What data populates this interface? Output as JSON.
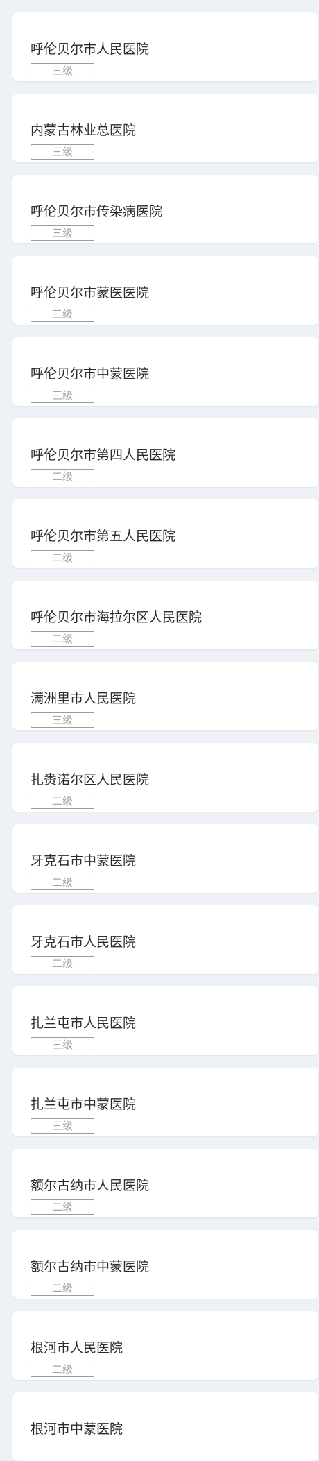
{
  "hospitals": [
    {
      "name": "呼伦贝尔市人民医院",
      "level": "三级"
    },
    {
      "name": "内蒙古林业总医院",
      "level": "三级"
    },
    {
      "name": "呼伦贝尔市传染病医院",
      "level": "三级"
    },
    {
      "name": "呼伦贝尔市蒙医医院",
      "level": "三级"
    },
    {
      "name": "呼伦贝尔市中蒙医院",
      "level": "三级"
    },
    {
      "name": "呼伦贝尔市第四人民医院",
      "level": "二级"
    },
    {
      "name": "呼伦贝尔市第五人民医院",
      "level": "二级"
    },
    {
      "name": "呼伦贝尔市海拉尔区人民医院",
      "level": "二级"
    },
    {
      "name": "满洲里市人民医院",
      "level": "三级"
    },
    {
      "name": "扎赉诺尔区人民医院",
      "level": "二级"
    },
    {
      "name": "牙克石市中蒙医院",
      "level": "二级"
    },
    {
      "name": "牙克石市人民医院",
      "level": "二级"
    },
    {
      "name": "扎兰屯市人民医院",
      "level": "三级"
    },
    {
      "name": "扎兰屯市中蒙医院",
      "level": "三级"
    },
    {
      "name": "额尔古纳市人民医院",
      "level": "二级"
    },
    {
      "name": "额尔古纳市中蒙医院",
      "level": "二级"
    },
    {
      "name": "根河市人民医院",
      "level": "二级"
    },
    {
      "name": "根河市中蒙医院",
      "level": ""
    }
  ]
}
